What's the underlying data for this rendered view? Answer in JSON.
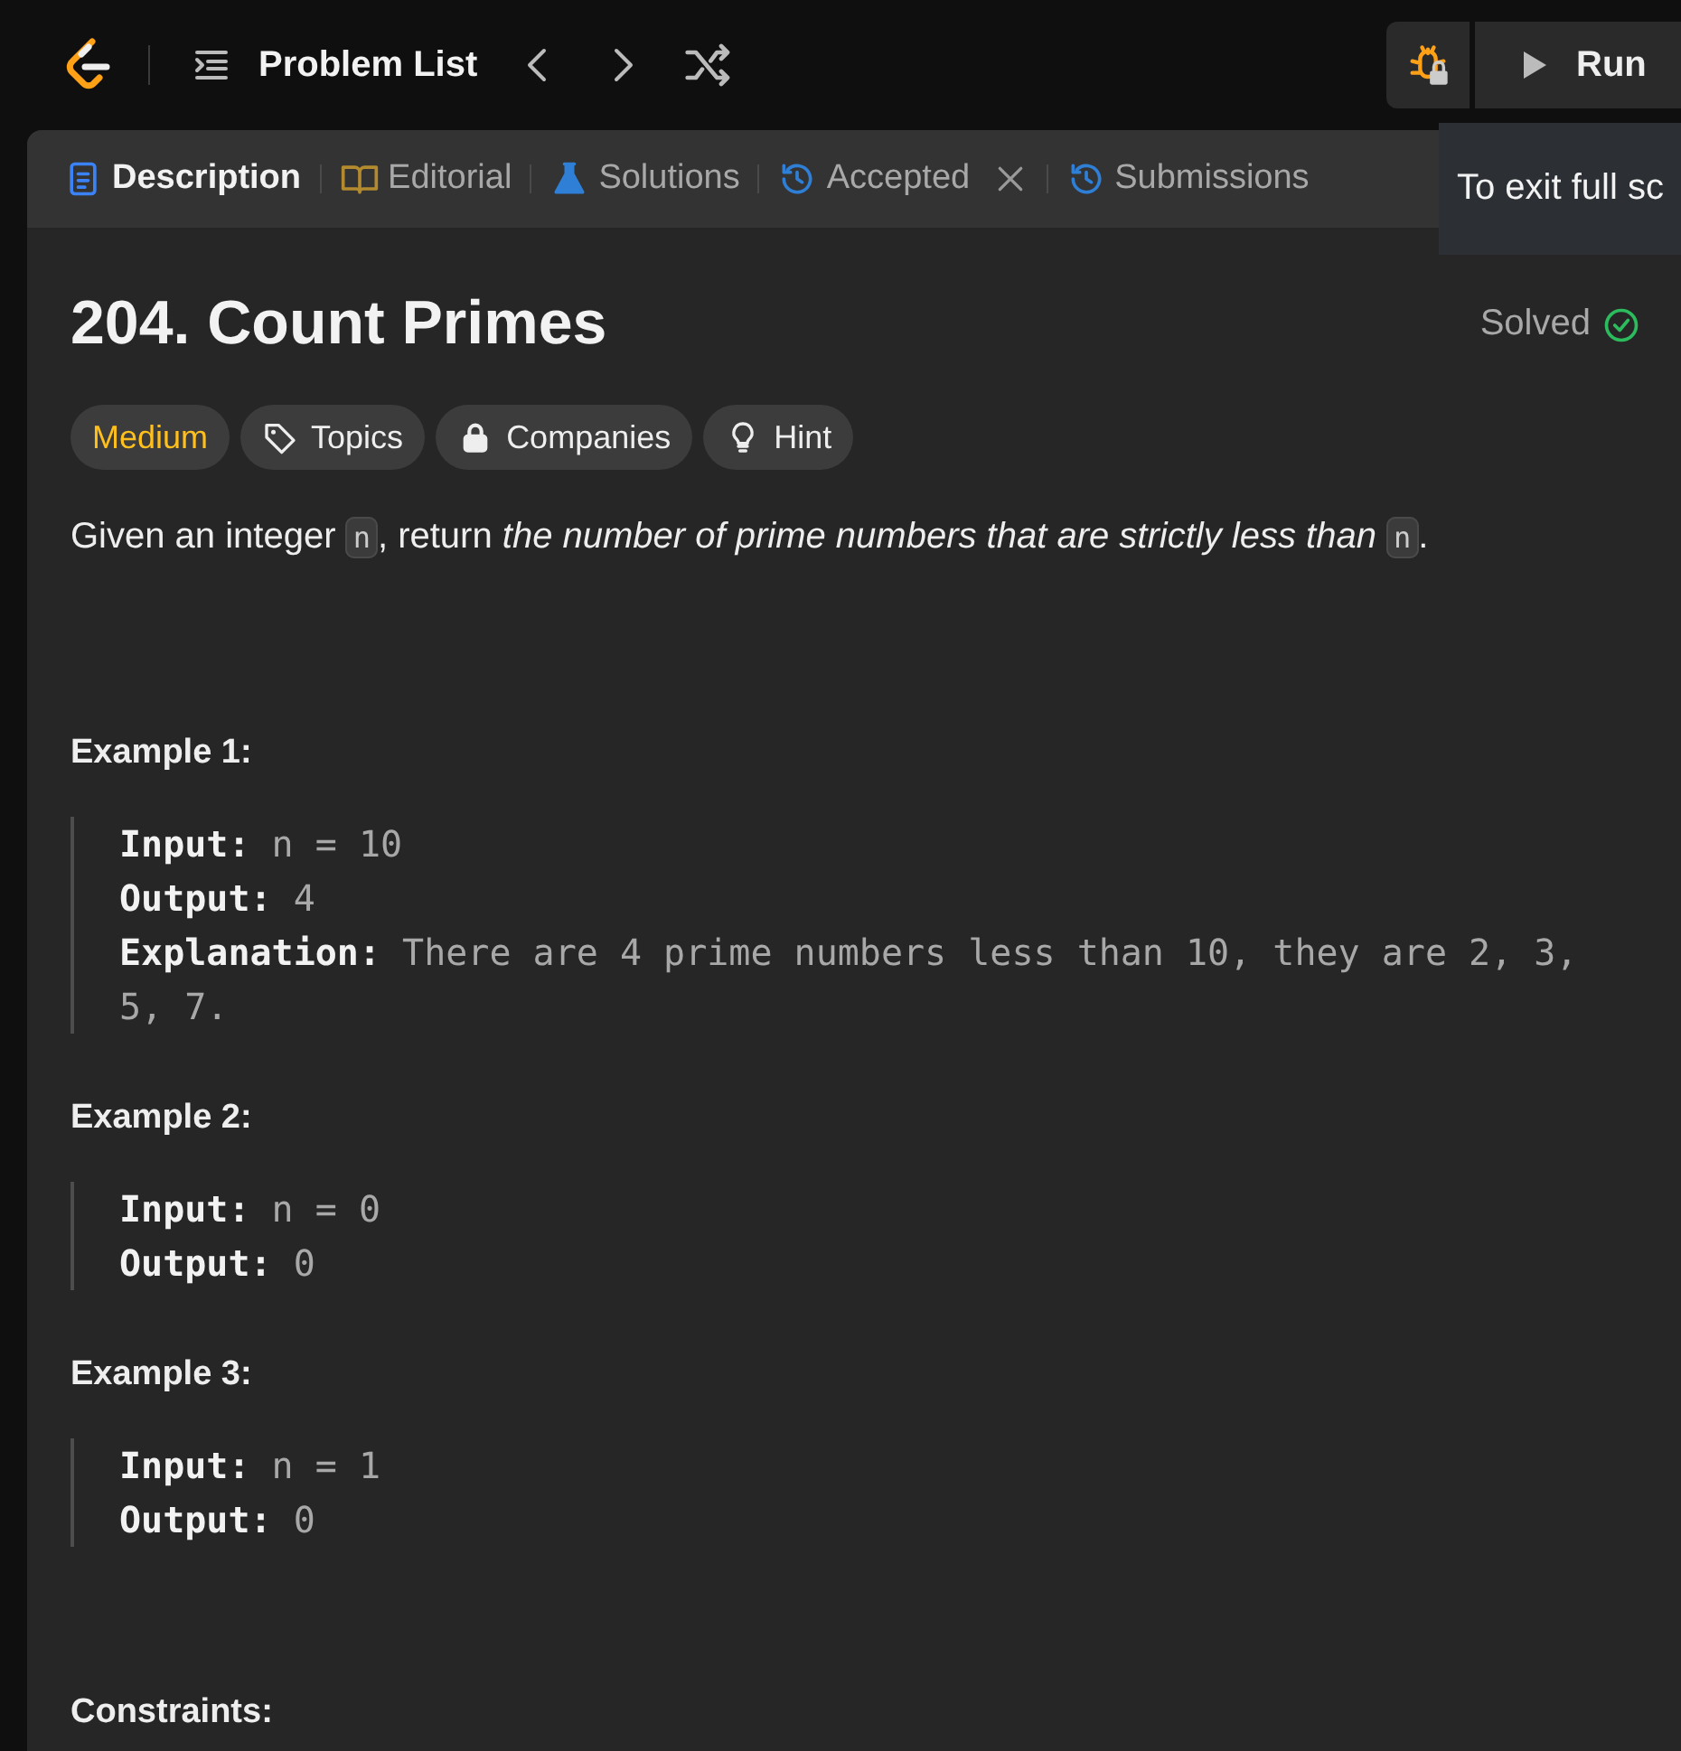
{
  "topbar": {
    "nav_title": "Problem List",
    "run_label": "Run"
  },
  "tabs": [
    {
      "label": "Description",
      "selected": true,
      "kind": "document",
      "closable": false
    },
    {
      "label": "Editorial",
      "selected": false,
      "kind": "book",
      "closable": false
    },
    {
      "label": "Solutions",
      "selected": false,
      "kind": "flask",
      "closable": false
    },
    {
      "label": "Accepted",
      "selected": false,
      "kind": "history",
      "closable": true
    },
    {
      "label": "Submissions",
      "selected": false,
      "kind": "history",
      "closable": false
    }
  ],
  "tooltip": "To exit full sc",
  "problem": {
    "title": "204. Count Primes",
    "status": "Solved",
    "tags": [
      {
        "label": "Medium",
        "kind": "difficulty"
      },
      {
        "label": "Topics",
        "kind": "topics"
      },
      {
        "label": "Companies",
        "kind": "companies"
      },
      {
        "label": "Hint",
        "kind": "hint"
      }
    ],
    "statement": [
      {
        "kind": "text",
        "text": "Given an integer "
      },
      {
        "kind": "code",
        "text": "n"
      },
      {
        "kind": "text",
        "text": ", return *the number of prime numbers that are strictly less than* "
      },
      {
        "kind": "code",
        "text": "n"
      },
      {
        "kind": "text",
        "text": "."
      }
    ],
    "examples": [
      {
        "heading": "Example 1:",
        "lines": [
          {
            "label": "Input:",
            "value": "n = 10"
          },
          {
            "label": "Output:",
            "value": "4"
          },
          {
            "label": "Explanation:",
            "value": "There are 4 prime numbers less than 10, they are 2, 3, 5, 7."
          }
        ]
      },
      {
        "heading": "Example 2:",
        "lines": [
          {
            "label": "Input:",
            "value": "n = 0"
          },
          {
            "label": "Output:",
            "value": "0"
          }
        ]
      },
      {
        "heading": "Example 3:",
        "lines": [
          {
            "label": "Input:",
            "value": "n = 1"
          },
          {
            "label": "Output:",
            "value": "0"
          }
        ]
      }
    ],
    "constraints_heading": "Constraints:"
  }
}
